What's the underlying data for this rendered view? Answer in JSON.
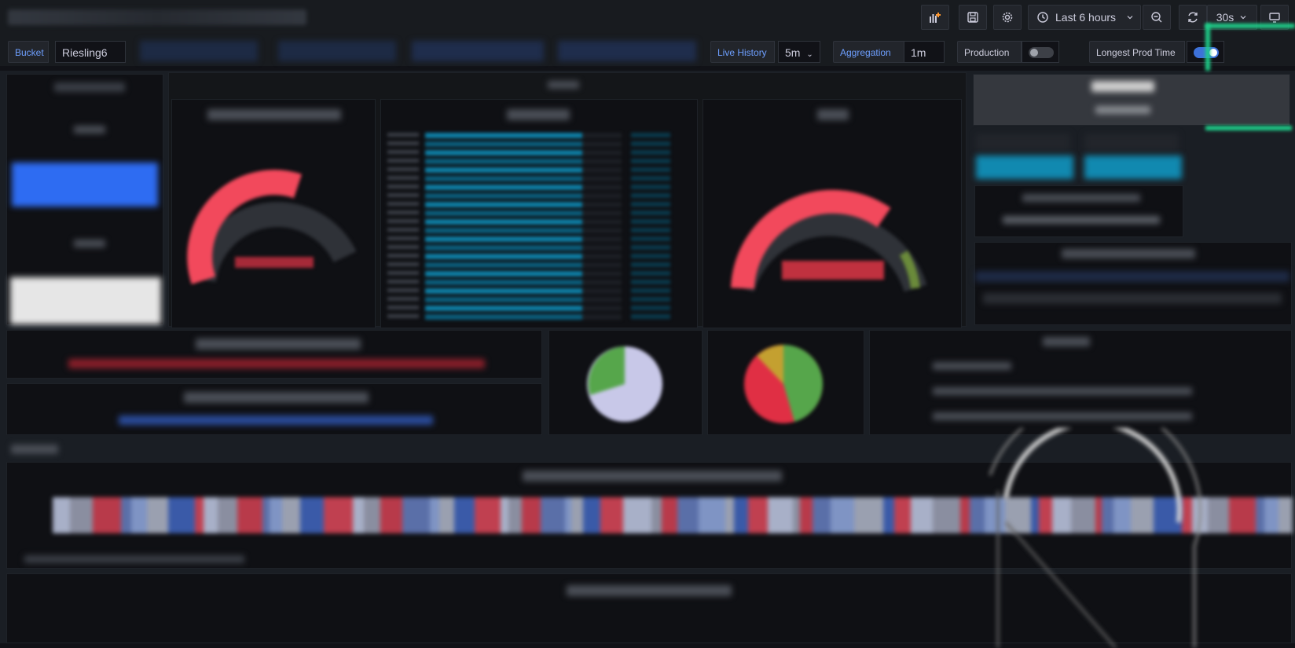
{
  "toolbar": {
    "time_range": "Last 6 hours",
    "refresh_interval": "30s",
    "icons": [
      "add-panel-icon",
      "save-icon",
      "gear-icon",
      "clock-icon",
      "zoom-out-icon",
      "refresh-icon",
      "tv-icon"
    ]
  },
  "variables": {
    "bucket_label": "Bucket",
    "bucket_value": "Riesling6",
    "live_history_label": "Live History",
    "live_history_value": "5m",
    "aggregation_label": "Aggregation",
    "aggregation_value": "1m",
    "production_label": "Production",
    "production_on": false,
    "longest_prod_label": "Longest Prod Time",
    "longest_prod_on": true
  },
  "colors": {
    "accent": "#6e9fff",
    "gauge_red": "#f2495c",
    "bar_blue": "#0e7fa6",
    "toggle_on": "#3d71d9",
    "green_highlight": "#1fcf8a"
  }
}
